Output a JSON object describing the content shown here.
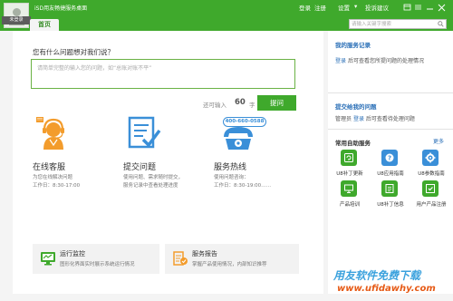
{
  "colors": {
    "brand_green": "#3fa92c",
    "link_blue": "#2a6fb7",
    "icon_orange": "#f39c2c",
    "icon_blue": "#3a8fd8"
  },
  "header": {
    "login_status": "未登录",
    "app_title": "iSD用友畅捷服务桌面",
    "tab_home": "首页",
    "login": "登录",
    "register": "注册",
    "settings": "设置",
    "feedback": "投诉建议",
    "search_placeholder": "请输入关键字搜索"
  },
  "question": {
    "title": "您有什么问题想对我们说？",
    "placeholder": "请简单完整的输入您的问题，如“总账对账不平”",
    "remaining_label": "还可输入",
    "remaining_count": "60",
    "remaining_unit": "字",
    "submit": "提问"
  },
  "services": [
    {
      "title": "在线客服",
      "desc1": "为您在线解决问题",
      "desc2": "工作日：8:30-17:00",
      "icon": "customer-service-icon"
    },
    {
      "title": "提交问题",
      "desc1": "使用问题、需求随时提交，",
      "desc2": "服务记录中查看处理进度",
      "icon": "submit-question-icon"
    },
    {
      "title": "服务热线",
      "desc1": "使用问题咨询：",
      "desc2": "工作日：8:30-19:00……",
      "icon": "hotline-phone-icon",
      "phone": "400-660-0588"
    }
  ],
  "features": [
    {
      "title": "运行监控",
      "desc": "图形化界面实时展示系统运行情况",
      "icon": "monitor-icon"
    },
    {
      "title": "服务报告",
      "desc": "掌握产品使用情况，内部知识推荐",
      "icon": "service-report-icon"
    }
  ],
  "sidebar": {
    "service_records_title": "我的服务记录",
    "service_records_link": "登录",
    "service_records_text": "后可查看您所提问题的处理情况",
    "submitted_title": "提交给我的问题",
    "submitted_prefix": "管理员",
    "submitted_link": "登录",
    "submitted_text": "后可查看待处理问题",
    "self_service_title": "常用自助服务",
    "more": "更多",
    "tiles": [
      {
        "label": "U8补丁更新",
        "icon": "patch-update-icon",
        "color": "#3fa92c"
      },
      {
        "label": "U8应用指南",
        "icon": "app-guide-icon",
        "color": "#3a8fd8"
      },
      {
        "label": "U8参数指南",
        "icon": "parameter-guide-icon",
        "color": "#3a8fd8"
      },
      {
        "label": "产品培训",
        "icon": "product-training-icon",
        "color": "#3fa92c"
      },
      {
        "label": "U8补丁信息",
        "icon": "patch-info-icon",
        "color": "#3fa92c"
      },
      {
        "label": "用户产品注册",
        "icon": "product-registration-icon",
        "color": "#3fa92c"
      }
    ]
  },
  "watermark": {
    "text": "用友软件免费下载",
    "url": "www.ufidawhy.com"
  }
}
